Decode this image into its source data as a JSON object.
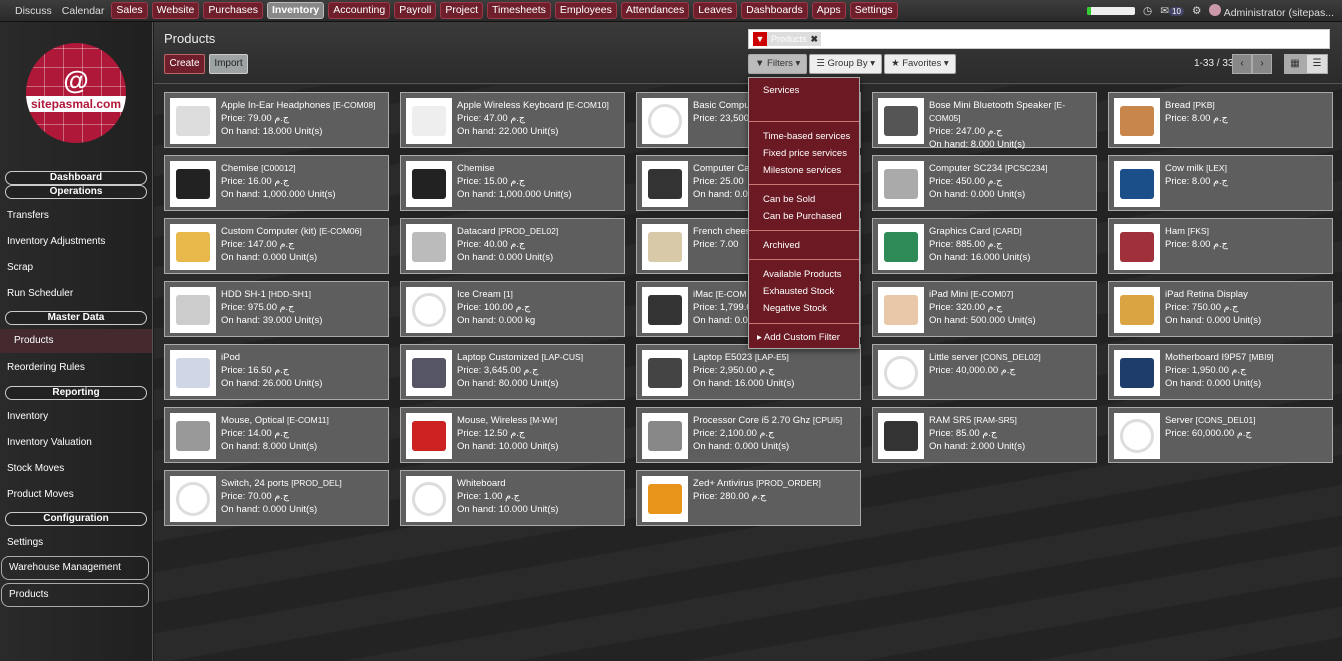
{
  "topbar": {
    "plain": [
      "Discuss",
      "Calendar"
    ],
    "apps": [
      "Sales",
      "Website",
      "Purchases",
      "Inventory",
      "Accounting",
      "Payroll",
      "Project",
      "Timesheets",
      "Employees",
      "Attendances",
      "Leaves",
      "Dashboards",
      "Apps",
      "Settings"
    ],
    "active_app": "Inventory",
    "progress_percent": 8,
    "notification_count": "10",
    "user": "Administrator (sitepas..."
  },
  "sidebar": {
    "logo_text": "sitepasmal.com",
    "sections": [
      {
        "label": "Dashboard"
      },
      {
        "label": "Operations"
      },
      {
        "label": "Master Data"
      },
      {
        "label": "Reporting"
      },
      {
        "label": "Configuration"
      }
    ],
    "items": {
      "transfers": "Transfers",
      "adjustments": "Inventory Adjustments",
      "scrap": "Scrap",
      "scheduler": "Run Scheduler",
      "products": "Products",
      "reordering": "Reordering Rules",
      "inventory": "Inventory",
      "valuation": "Inventory Valuation",
      "stock_moves": "Stock Moves",
      "product_moves": "Product Moves",
      "settings": "Settings",
      "warehouse": "Warehouse Management",
      "products2": "Products"
    }
  },
  "header": {
    "title": "Products",
    "create": "Create",
    "import": "Import",
    "facet_value": "Products",
    "filters": "Filters",
    "group_by": "Group By",
    "favorites": "Favorites",
    "pager": "1-33 / 33"
  },
  "dropdown": [
    "Services",
    "Time-based services",
    "Fixed price services",
    "Milestone services",
    "Can be Sold",
    "Can be Purchased",
    "Archived",
    "Available Products",
    "Exhausted Stock",
    "Negative Stock",
    "Add Custom Filter"
  ],
  "products": [
    {
      "name": "Apple In-Ear Headphones",
      "code": "[E-COM08]",
      "price": "Price: 79.00 ج.م",
      "onhand": "On hand: 18.000 Unit(s)",
      "img": "#ddd"
    },
    {
      "name": "Apple Wireless Keyboard",
      "code": "[E-COM10]",
      "price": "Price: 47.00 ج.م",
      "onhand": "On hand: 22.000 Unit(s)",
      "img": "#eee"
    },
    {
      "name": "Basic Compu",
      "code": "",
      "price": "Price: 23,500.0",
      "onhand": "",
      "img": "ph"
    },
    {
      "name": "Bose Mini Bluetooth Speaker",
      "code": "[E-COM05]",
      "price": "Price: 247.00 ج.م",
      "onhand": "On hand: 8.000 Unit(s)",
      "img": "#555"
    },
    {
      "name": "Bread",
      "code": "[PKB]",
      "price": "Price: 8.00 ج.م",
      "onhand": "",
      "img": "#c8864a"
    },
    {
      "name": "Chemise",
      "code": "[C00012]",
      "price": "Price: 16.00 ج.م",
      "onhand": "On hand: 1,000.000 Unit(s)",
      "img": "#222"
    },
    {
      "name": "Chemise",
      "code": "",
      "price": "Price: 15.00 ج.م",
      "onhand": "On hand: 1,000.000 Unit(s)",
      "img": "#222"
    },
    {
      "name": "Computer Cas",
      "code": "",
      "price": "Price: 25.00",
      "onhand": "On hand: 0.00",
      "img": "#333"
    },
    {
      "name": "Computer SC234",
      "code": "[PCSC234]",
      "price": "Price: 450.00 ج.م",
      "onhand": "On hand: 0.000 Unit(s)",
      "img": "#aaa"
    },
    {
      "name": "Cow milk",
      "code": "[LEX]",
      "price": "Price: 8.00 ج.م",
      "onhand": "",
      "img": "#1a4f8a"
    },
    {
      "name": "Custom Computer (kit)",
      "code": "[E-COM06]",
      "price": "Price: 147.00 ج.م",
      "onhand": "On hand: 0.000 Unit(s)",
      "img": "#e8b84a"
    },
    {
      "name": "Datacard",
      "code": "[PROD_DEL02]",
      "price": "Price: 40.00 ج.م",
      "onhand": "On hand: 0.000 Unit(s)",
      "img": "#bbb"
    },
    {
      "name": "French chees",
      "code": "",
      "price": "Price: 7.00",
      "onhand": "",
      "img": "#d8c9a8"
    },
    {
      "name": "Graphics Card",
      "code": "[CARD]",
      "price": "Price: 885.00 ج.م",
      "onhand": "On hand: 16.000 Unit(s)",
      "img": "#2e8b57"
    },
    {
      "name": "Ham",
      "code": "[FKS]",
      "price": "Price: 8.00 ج.م",
      "onhand": "",
      "img": "#a0303a"
    },
    {
      "name": "HDD SH-1",
      "code": "[HDD-SH1]",
      "price": "Price: 975.00 ج.م",
      "onhand": "On hand: 39.000 Unit(s)",
      "img": "#ccc"
    },
    {
      "name": "Ice Cream",
      "code": "[1]",
      "price": "Price: 100.00 ج.م",
      "onhand": "On hand: 0.000 kg",
      "img": "ph"
    },
    {
      "name": "iMac",
      "code": "[E-COM",
      "price": "Price: 1,799.0",
      "onhand": "On hand: 0.00",
      "img": "#333"
    },
    {
      "name": "iPad Mini",
      "code": "[E-COM07]",
      "price": "Price: 320.00 ج.م",
      "onhand": "On hand: 500.000 Unit(s)",
      "img": "#e8c8a8"
    },
    {
      "name": "iPad Retina Display",
      "code": "",
      "price": "Price: 750.00 ج.م",
      "onhand": "On hand: 0.000 Unit(s)",
      "img": "#d9a441"
    },
    {
      "name": "iPod",
      "code": "",
      "price": "Price: 16.50 ج.م",
      "onhand": "On hand: 26.000 Unit(s)",
      "img": "#cfd6e6"
    },
    {
      "name": "Laptop Customized",
      "code": "[LAP-CUS]",
      "price": "Price: 3,645.00 ج.م",
      "onhand": "On hand: 80.000 Unit(s)",
      "img": "#556"
    },
    {
      "name": "Laptop E5023",
      "code": "[LAP-E5]",
      "price": "Price: 2,950.00 ج.م",
      "onhand": "On hand: 16.000 Unit(s)",
      "img": "#444"
    },
    {
      "name": "Little server",
      "code": "[CONS_DEL02]",
      "price": "Price: 40,000.00 ج.م",
      "onhand": "",
      "img": "ph"
    },
    {
      "name": "Motherboard I9P57",
      "code": "[MBI9]",
      "price": "Price: 1,950.00 ج.م",
      "onhand": "On hand: 0.000 Unit(s)",
      "img": "#1f3d6b"
    },
    {
      "name": "Mouse, Optical",
      "code": "[E-COM11]",
      "price": "Price: 14.00 ج.م",
      "onhand": "On hand: 8.000 Unit(s)",
      "img": "#999"
    },
    {
      "name": "Mouse, Wireless",
      "code": "[M-Wir]",
      "price": "Price: 12.50 ج.م",
      "onhand": "On hand: 10.000 Unit(s)",
      "img": "#c22"
    },
    {
      "name": "Processor Core i5 2.70 Ghz",
      "code": "[CPUi5]",
      "price": "Price: 2,100.00 ج.م",
      "onhand": "On hand: 0.000 Unit(s)",
      "img": "#888"
    },
    {
      "name": "RAM SR5",
      "code": "[RAM-SR5]",
      "price": "Price: 85.00 ج.م",
      "onhand": "On hand: 2.000 Unit(s)",
      "img": "#333"
    },
    {
      "name": "Server",
      "code": "[CONS_DEL01]",
      "price": "Price: 60,000.00 ج.م",
      "onhand": "",
      "img": "ph"
    },
    {
      "name": "Switch, 24 ports",
      "code": "[PROD_DEL]",
      "price": "Price: 70.00 ج.م",
      "onhand": "On hand: 0.000 Unit(s)",
      "img": "ph"
    },
    {
      "name": "Whiteboard",
      "code": "",
      "price": "Price: 1.00 ج.م",
      "onhand": "On hand: 10.000 Unit(s)",
      "img": "ph"
    },
    {
      "name": "Zed+ Antivirus",
      "code": "[PROD_ORDER]",
      "price": "Price: 280.00 ج.م",
      "onhand": "",
      "img": "#e8941a"
    }
  ]
}
